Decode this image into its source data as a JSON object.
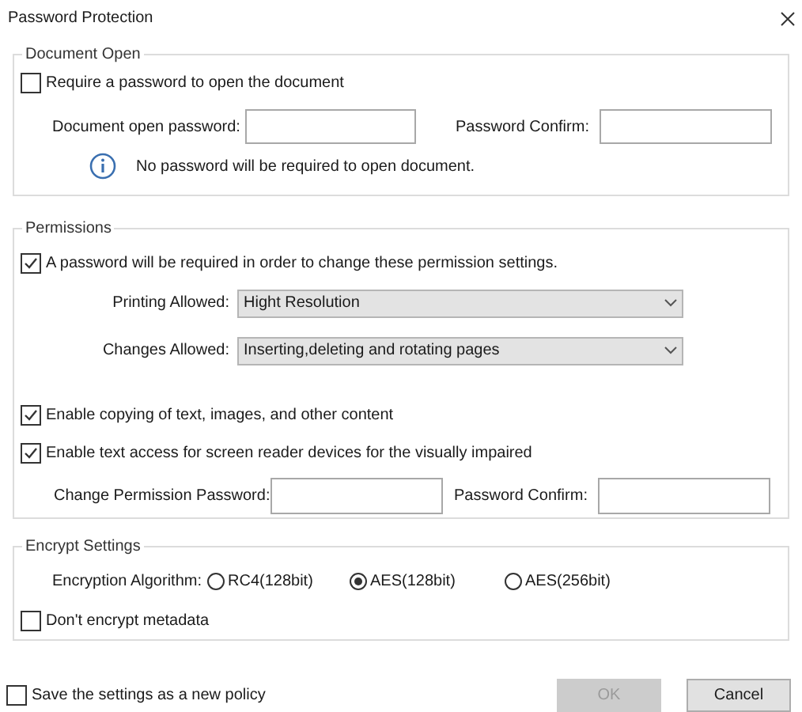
{
  "window": {
    "title": "Password Protection"
  },
  "document_open": {
    "legend": "Document Open",
    "checkbox": {
      "label": "Require a password to open the document",
      "checked": false
    },
    "fields": [
      {
        "label": "Document open password:"
      },
      {
        "label": "Password Confirm:"
      }
    ],
    "info": "No password will be required to open document."
  },
  "permissions": {
    "legend": "Permissions",
    "checkbox": {
      "label": "A password will be required in order to change these permission settings.",
      "checked": true
    },
    "selects": [
      {
        "label": "Printing Allowed:",
        "value": "Hight Resolution"
      },
      {
        "label": "Changes Allowed:",
        "value": "Inserting,deleting and rotating pages"
      }
    ],
    "checkboxes": [
      {
        "label": "Enable copying of text, images, and other content",
        "checked": true
      },
      {
        "label": "Enable text access for screen reader devices for the visually impaired",
        "checked": true
      }
    ],
    "fields": [
      {
        "label": "Change Permission Password:"
      },
      {
        "label": "Password Confirm:"
      }
    ]
  },
  "encrypt": {
    "legend": "Encrypt Settings",
    "algorithm_label": "Encryption Algorithm:",
    "options": [
      {
        "label": "RC4(128bit)",
        "selected": false
      },
      {
        "label": "AES(128bit)",
        "selected": true
      },
      {
        "label": "AES(256bit)",
        "selected": false
      }
    ],
    "checkbox": {
      "label": "Don't encrypt metadata",
      "checked": false
    }
  },
  "footer": {
    "checkbox": {
      "label": "Save the settings as a new policy",
      "checked": false
    },
    "buttons": [
      {
        "label": "OK",
        "disabled": true
      },
      {
        "label": "Cancel",
        "disabled": false
      }
    ]
  }
}
